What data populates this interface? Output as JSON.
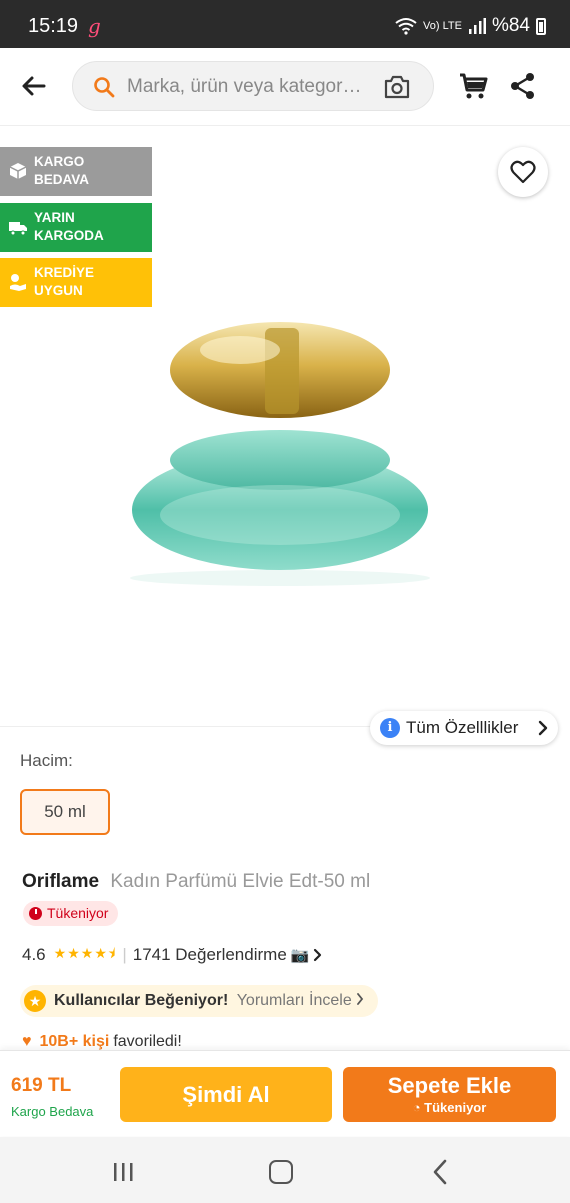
{
  "status_bar": {
    "time": "15:19",
    "app_indicator": "g",
    "volte": "Vo) LTE",
    "battery": "%84"
  },
  "header": {
    "search_placeholder": "Marka, ürün veya kategor…",
    "icons": [
      "back-arrow-icon",
      "search-icon",
      "camera-icon",
      "cart-icon",
      "share-icon"
    ]
  },
  "badges": [
    {
      "line1": "KARGO",
      "line2": "BEDAVA",
      "color": "#9b9b9b",
      "icon": "box-icon"
    },
    {
      "line1": "YARIN",
      "line2": "KARGODA",
      "color": "#1fa44b",
      "icon": "truck-icon"
    },
    {
      "line1": "KREDİYE",
      "line2": "UYGUN",
      "color": "#ffc107",
      "icon": "coins-icon"
    }
  ],
  "specs_button": "Tüm Özelllikler",
  "variant": {
    "label": "Hacim:",
    "options": [
      "50 ml"
    ],
    "selected": "50 ml"
  },
  "product": {
    "brand": "Oriflame",
    "name": "Kadın Parfümü Elvie Edt-50 ml",
    "stock_badge": "Tükeniyor",
    "rating": "4.6",
    "stars_filled": 4.6,
    "reviews": "1741 Değerlendirme"
  },
  "highlight": {
    "bold": "Kullanıcılar Beğeniyor!",
    "link": "Yorumları İncele"
  },
  "favorites": {
    "count": "10B+ kişi",
    "text": "favoriledi!"
  },
  "bottom_bar": {
    "price": "619 TL",
    "shipping": "Kargo Bedava",
    "buy_now": "Şimdi Al",
    "add_to_cart": "Sepete Ekle",
    "add_to_cart_sub": "Tükeniyor"
  },
  "colors": {
    "accent": "#f27a1a",
    "buy_now": "#ffb21a",
    "green": "#1fa44b",
    "stock_red": "#d0021b"
  }
}
